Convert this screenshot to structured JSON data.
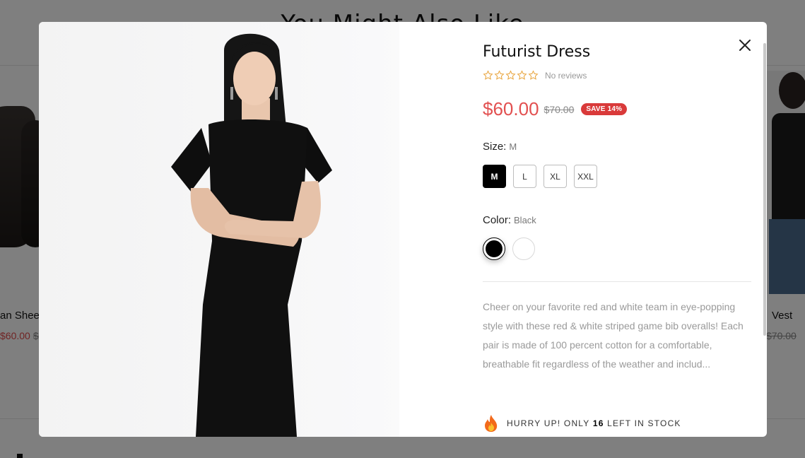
{
  "background": {
    "heading": "You Might Also Like",
    "left_product": {
      "name": "an Shee",
      "price": "60.00",
      "compare_price": "$"
    },
    "right_product": {
      "name": "Vest",
      "compare_price": "$70.00"
    }
  },
  "modal": {
    "close_icon": "close-icon",
    "product": {
      "title": "Futurist Dress",
      "rating": {
        "stars": 0,
        "max": 5,
        "text": "No reviews"
      },
      "price": "$60.00",
      "compare_price": "$70.00",
      "save_badge": "SAVE 14%"
    },
    "size": {
      "label": "Size:",
      "selected": "M",
      "options": [
        "M",
        "L",
        "XL",
        "XXL"
      ]
    },
    "color": {
      "label": "Color:",
      "selected": "Black",
      "options": [
        {
          "name": "Black",
          "hex": "#000000"
        },
        {
          "name": "White",
          "hex": "#ffffff"
        }
      ]
    },
    "description": "Cheer on your favorite red and white team in eye-popping style with these red & white striped game bib overalls! Each pair is made of 100 percent cotton for a comfortable, breathable fit regardless of the weather and includ...",
    "stock": {
      "prefix": "HURRY UP! ONLY",
      "count": "16",
      "suffix": "LEFT IN STOCK",
      "icon": "fire-icon"
    }
  },
  "colors": {
    "accent_price": "#e25050",
    "badge": "#d93a3a",
    "star": "#e8a33a"
  }
}
